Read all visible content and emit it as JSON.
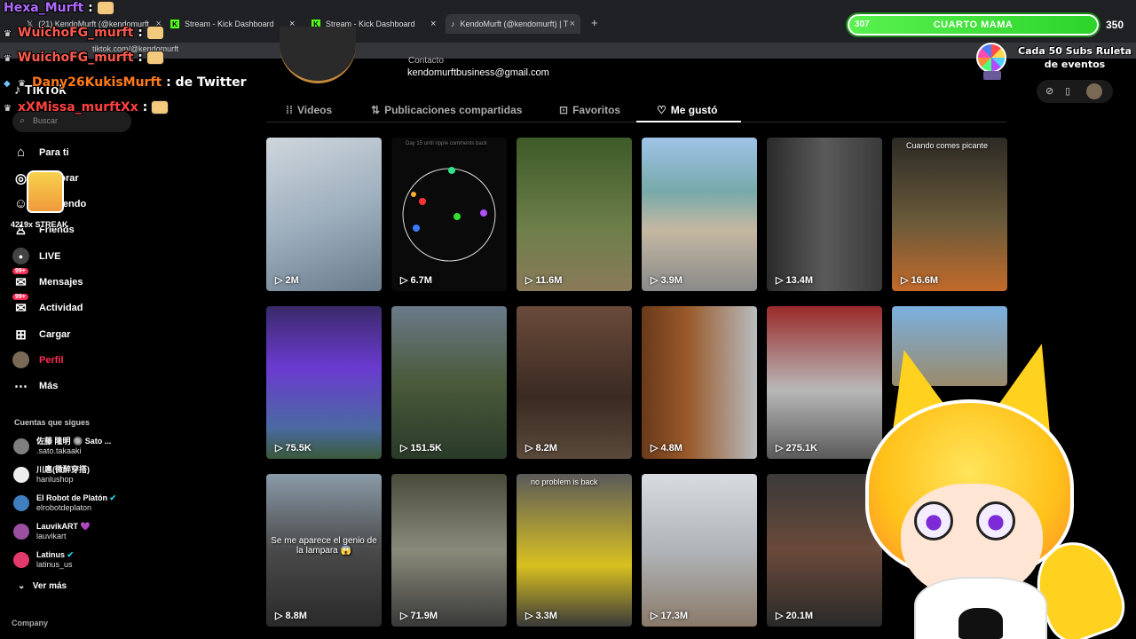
{
  "browser": {
    "tabs": [
      {
        "label": "(21) KendoMurft (@kendomurft",
        "icon": "x-logo"
      },
      {
        "label": "Stream - Kick Dashboard",
        "icon": "kick-logo"
      },
      {
        "label": "Stream - Kick Dashboard",
        "icon": "kick-logo"
      },
      {
        "label": "KendoMurft (@kendomurft) | T",
        "icon": "tiktok-logo",
        "active": true
      }
    ],
    "new_tab": "+",
    "url": "tiktok.com/@kendomurft"
  },
  "overlay": {
    "chat": [
      {
        "user": "Hexa_Murft",
        "msg": ":"
      },
      {
        "user": "WuichoFG_murft",
        "msg": ":"
      },
      {
        "user": "WuichoFG_murft",
        "msg": ":"
      },
      {
        "user": "Dany26KukisMurft",
        "msg": ": de Twitter"
      },
      {
        "user": "xXMissa_murftXx",
        "msg": ":"
      }
    ],
    "sub_count": "307",
    "sub_label": "CUARTO MAMA",
    "sub_goal": "350",
    "wheel_text": "Cada 50 Subs Ruleta de eventos",
    "streak": "4219x STREAK"
  },
  "tiktok": {
    "logo": "TikTok",
    "search_placeholder": "Buscar",
    "nav": [
      {
        "label": "Para ti",
        "icon": "home-icon"
      },
      {
        "label": "Explorar",
        "icon": "compass-icon"
      },
      {
        "label": "Siguiendo",
        "icon": "following-icon"
      },
      {
        "label": "Friends",
        "icon": "friends-icon"
      },
      {
        "label": "LIVE",
        "icon": "live-icon"
      },
      {
        "label": "Mensajes",
        "icon": "messages-icon",
        "badge": "99+"
      },
      {
        "label": "Actividad",
        "icon": "activity-icon",
        "badge": "99+"
      },
      {
        "label": "Cargar",
        "icon": "upload-icon"
      },
      {
        "label": "Perfil",
        "icon": "profile-icon",
        "active": true
      },
      {
        "label": "Más",
        "icon": "more-icon"
      }
    ],
    "following_title": "Cuentas que sigues",
    "following": [
      {
        "name": "佐藤 隆明 🔘 Sato ...",
        "handle": ".sato.takaaki"
      },
      {
        "name": "川扈(微醉穿搭)",
        "handle": "hanlushop"
      },
      {
        "name": "El Robot de Platón",
        "handle": "elrobotdeplaton"
      },
      {
        "name": "LauvikART 💜",
        "handle": "lauvikart"
      },
      {
        "name": "Latinus",
        "handle": "latinus_us"
      }
    ],
    "see_more": "Ver más",
    "company": "Company"
  },
  "profile": {
    "contact_label": "Contacto",
    "email": "kendomurftbusiness@gmail.com",
    "tabs": [
      {
        "label": "Videos",
        "icon": "grid-icon"
      },
      {
        "label": "Publicaciones compartidas",
        "icon": "repost-icon"
      },
      {
        "label": "Favoritos",
        "icon": "bookmark-icon"
      },
      {
        "label": "Me gustó",
        "icon": "heart-icon",
        "active": true
      }
    ]
  },
  "videos": [
    {
      "views": "2M",
      "caption": "",
      "top": ""
    },
    {
      "views": "6.7M",
      "caption": "",
      "top": "Day 15 until ripple comments back"
    },
    {
      "views": "11.6M",
      "caption": "",
      "top": ""
    },
    {
      "views": "3.9M",
      "caption": "",
      "top": ""
    },
    {
      "views": "13.4M",
      "caption": "",
      "top": ""
    },
    {
      "views": "16.6M",
      "caption": "",
      "top": "Cuando comes picante"
    },
    {
      "views": "75.5K",
      "caption": "",
      "top": ""
    },
    {
      "views": "151.5K",
      "caption": "",
      "top": ""
    },
    {
      "views": "8.2M",
      "caption": "",
      "top": ""
    },
    {
      "views": "4.8M",
      "caption": "",
      "top": ""
    },
    {
      "views": "275.1K",
      "caption": "",
      "top": ""
    },
    {
      "views": "",
      "caption": "",
      "top": ""
    },
    {
      "views": "8.8M",
      "caption": "Se me aparece el genio de la lampara 😱",
      "top": ""
    },
    {
      "views": "71.9M",
      "caption": "",
      "top": ""
    },
    {
      "views": "3.3M",
      "caption": "",
      "top": "no problem is back"
    },
    {
      "views": "17.3M",
      "caption": "",
      "top": ""
    },
    {
      "views": "20.1M",
      "caption": "",
      "top": ""
    },
    {
      "views": "",
      "caption": "",
      "top": ""
    }
  ],
  "colors": {
    "accent": "#fe2c55",
    "kick": "#53fc18",
    "subbar": "#3ad83a"
  }
}
